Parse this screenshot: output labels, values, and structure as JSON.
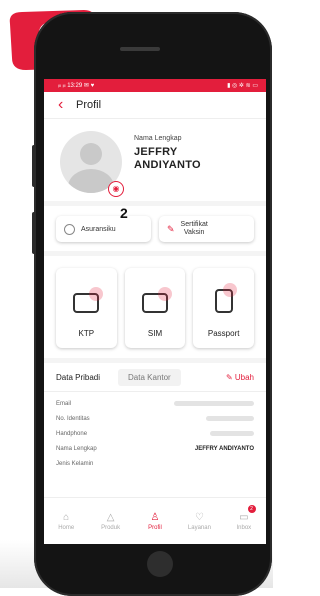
{
  "step_badge": "2",
  "status": {
    "left": "ᵢₗₗ ᵢₗₗ 13:29 ✉ ♥",
    "right": "▮ ◎ ✲ ≋ ▭"
  },
  "header": {
    "title": "Profil"
  },
  "profile": {
    "name_label": "Nama Lengkap",
    "name_line1": "JEFFRY",
    "name_line2": "ANDIYANTO"
  },
  "annotation": "2",
  "quick": [
    {
      "label": "Asuransiku"
    },
    {
      "label": "Sertifikat\nVaksin"
    }
  ],
  "docs": [
    {
      "label": "KTP"
    },
    {
      "label": "SIM"
    },
    {
      "label": "Passport"
    }
  ],
  "tabs": {
    "personal": "Data Pribadi",
    "office": "Data Kantor",
    "edit": "Ubah"
  },
  "fields": [
    {
      "label": "Email",
      "value": ""
    },
    {
      "label": "No. Identitas",
      "value": ""
    },
    {
      "label": "Handphone",
      "value": ""
    },
    {
      "label": "Nama Lengkap",
      "value": "JEFFRY ANDIYANTO"
    },
    {
      "label": "Jenis Kelamin",
      "value": ""
    }
  ],
  "nav": [
    {
      "label": "Home",
      "icon": "home-icon"
    },
    {
      "label": "Produk",
      "icon": "product-icon"
    },
    {
      "label": "Profil",
      "icon": "profile-icon"
    },
    {
      "label": "Layanan",
      "icon": "service-icon"
    },
    {
      "label": "Inbox",
      "icon": "inbox-icon",
      "badge": "2"
    }
  ],
  "colors": {
    "accent": "#e31e3c"
  }
}
